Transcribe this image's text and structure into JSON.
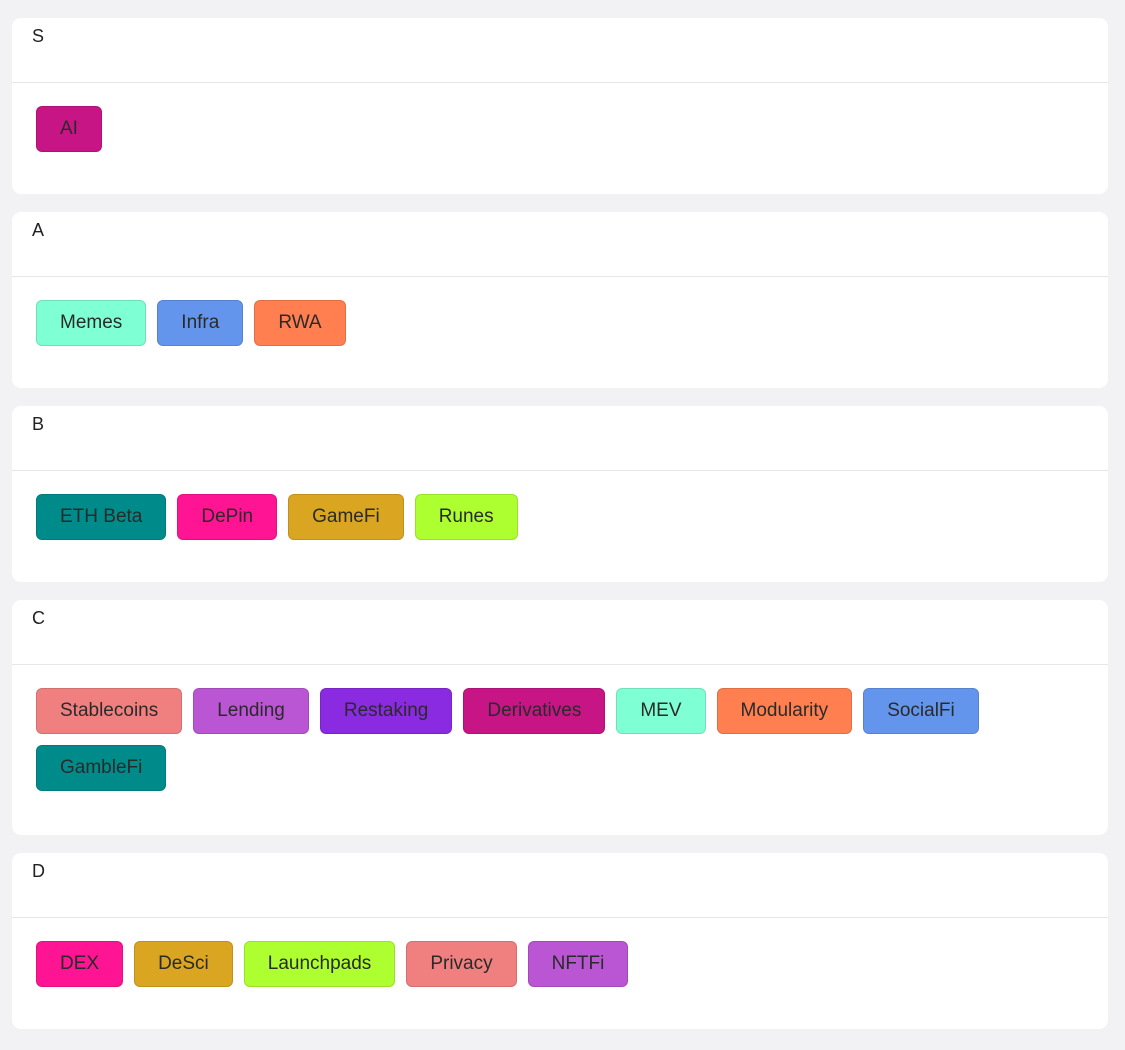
{
  "tiers": [
    {
      "label": "S",
      "tags": [
        {
          "label": "AI",
          "color": "#c71585"
        }
      ]
    },
    {
      "label": "A",
      "tags": [
        {
          "label": "Memes",
          "color": "#7fffd4"
        },
        {
          "label": "Infra",
          "color": "#6495ed"
        },
        {
          "label": "RWA",
          "color": "#ff7f50"
        }
      ]
    },
    {
      "label": "B",
      "tags": [
        {
          "label": "ETH Beta",
          "color": "#008b8b"
        },
        {
          "label": "DePin",
          "color": "#ff1493"
        },
        {
          "label": "GameFi",
          "color": "#daa520"
        },
        {
          "label": "Runes",
          "color": "#adff2f"
        }
      ]
    },
    {
      "label": "C",
      "tags": [
        {
          "label": "Stablecoins",
          "color": "#f08080"
        },
        {
          "label": "Lending",
          "color": "#ba55d3"
        },
        {
          "label": "Restaking",
          "color": "#8a2be2"
        },
        {
          "label": "Derivatives",
          "color": "#c71585"
        },
        {
          "label": "MEV",
          "color": "#7fffd4"
        },
        {
          "label": "Modularity",
          "color": "#ff7f50"
        },
        {
          "label": "SocialFi",
          "color": "#6495ed"
        },
        {
          "label": "GambleFi",
          "color": "#008b8b"
        }
      ]
    },
    {
      "label": "D",
      "tags": [
        {
          "label": "DEX",
          "color": "#ff1493"
        },
        {
          "label": "DeSci",
          "color": "#daa520"
        },
        {
          "label": "Launchpads",
          "color": "#adff2f"
        },
        {
          "label": "Privacy",
          "color": "#f08080"
        },
        {
          "label": "NFTFi",
          "color": "#ba55d3"
        }
      ]
    }
  ]
}
